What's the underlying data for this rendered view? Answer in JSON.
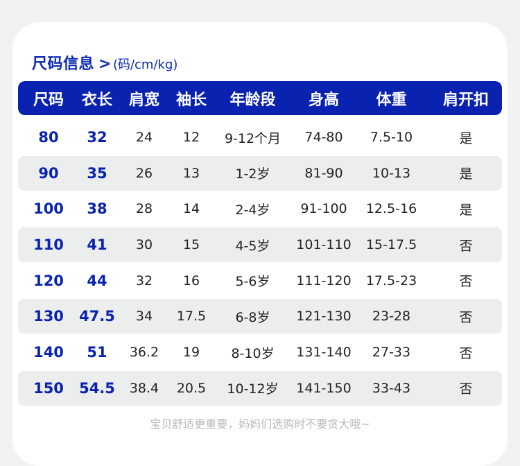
{
  "title": {
    "main": "尺码信息",
    "arrow": ">",
    "unit": "(码/cm/kg)"
  },
  "columns": [
    "尺码",
    "衣长",
    "肩宽",
    "袖长",
    "年龄段",
    "身高",
    "体重",
    "肩开扣"
  ],
  "rows": [
    [
      "80",
      "32",
      "24",
      "12",
      "9-12个月",
      "74-80",
      "7.5-10",
      "是"
    ],
    [
      "90",
      "35",
      "26",
      "13",
      "1-2岁",
      "81-90",
      "10-13",
      "是"
    ],
    [
      "100",
      "38",
      "28",
      "14",
      "2-4岁",
      "91-100",
      "12.5-16",
      "是"
    ],
    [
      "110",
      "41",
      "30",
      "15",
      "4-5岁",
      "101-110",
      "15-17.5",
      "否"
    ],
    [
      "120",
      "44",
      "32",
      "16",
      "5-6岁",
      "111-120",
      "17.5-23",
      "否"
    ],
    [
      "130",
      "47.5",
      "34",
      "17.5",
      "6-8岁",
      "121-130",
      "23-28",
      "否"
    ],
    [
      "140",
      "51",
      "36.2",
      "19",
      "8-10岁",
      "131-140",
      "27-33",
      "否"
    ],
    [
      "150",
      "54.5",
      "38.4",
      "20.5",
      "10-12岁",
      "141-150",
      "33-43",
      "否"
    ]
  ],
  "footer": "宝贝舒适更重要，妈妈们选购时不要贪大哦~",
  "colors": {
    "accent": "#0a22b0",
    "row_shade": "#eceeee",
    "footer_text": "#b9b9b9"
  }
}
